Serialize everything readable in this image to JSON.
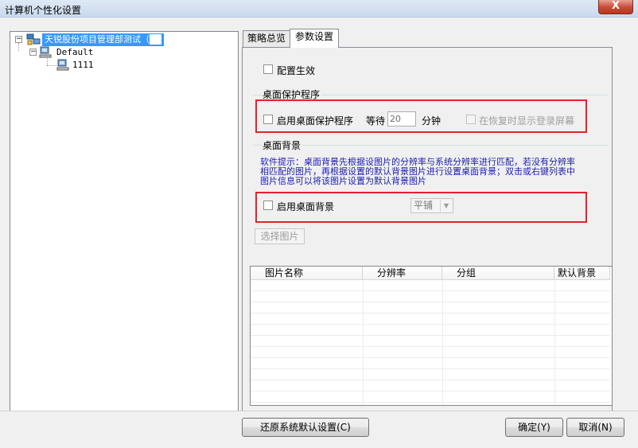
{
  "window": {
    "title": "计算机个性化设置",
    "close_label": "X"
  },
  "tree": {
    "root": {
      "label": "天锐股份项目管理部测试（",
      "redacted_suffix": "    ）",
      "expander": "−"
    },
    "group": {
      "label": "Default",
      "expander": "−"
    },
    "leaf": {
      "label": "1111"
    }
  },
  "tabs": [
    {
      "label": "策略总览"
    },
    {
      "label": "参数设置"
    }
  ],
  "settings": {
    "config_enable_label": "配置生效",
    "screensaver": {
      "group_title": "桌面保护程序",
      "enable_label": "启用桌面保护程序",
      "wait_label": "等待",
      "wait_value": "20",
      "unit_label": "分钟",
      "show_login_label": "在恢复时显示登录屏幕"
    },
    "wallpaper": {
      "group_title": "桌面背景",
      "hint_line1": "软件提示：桌面背景先根据设图片的分辨率与系统分辨率进行匹配，若没有分辨率",
      "hint_line2": "相匹配的图片，再根据设置的默认背景图片进行设置桌面背景；双击或右键列表中",
      "hint_line3": "图片信息可以将该图片设置为默认背景图片",
      "enable_label": "启用桌面背景",
      "position_value": "平铺",
      "choose_button": "选择图片"
    }
  },
  "table": {
    "columns": [
      "图片名称",
      "分辨率",
      "分组",
      "默认背景"
    ]
  },
  "buttons": {
    "restore": "还原系统默认设置(C)",
    "ok": "确定(Y)",
    "cancel": "取消(N)"
  },
  "colors": {
    "highlight_box": "#e8202a",
    "hint_text": "#1b1bb5",
    "selection": "#3399ff"
  }
}
